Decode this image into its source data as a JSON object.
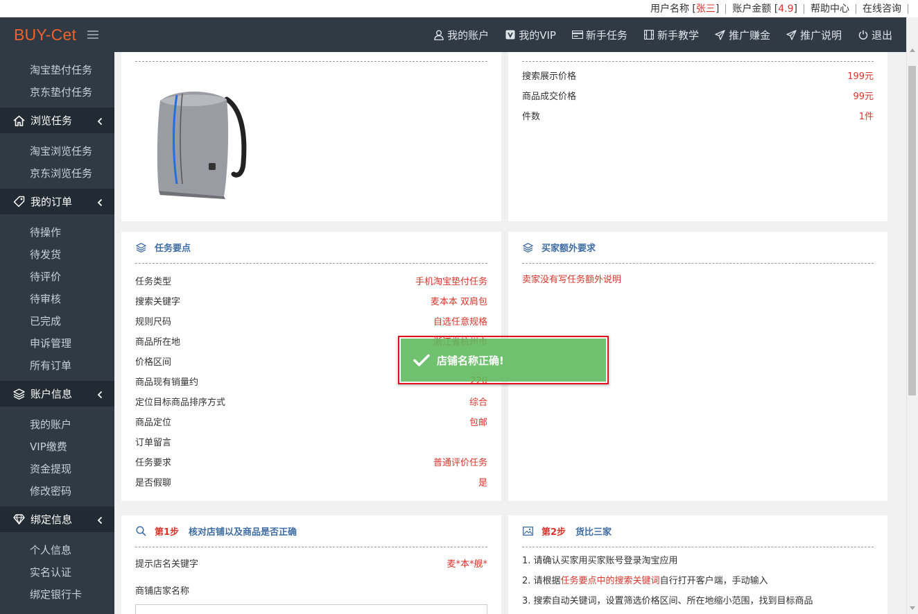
{
  "topbar": {
    "username_label": "用户名称 [",
    "username_value": "张三",
    "username_close": "]",
    "balance_label": "账户金额 [",
    "balance_value": "4.9",
    "balance_close": "]",
    "help": "帮助中心",
    "consult": "在线咨询"
  },
  "header": {
    "logo": "BUY-Cet",
    "nav": [
      {
        "label": "我的账户",
        "icon": "user-icon"
      },
      {
        "label": "我的VIP",
        "icon": "vip-icon"
      },
      {
        "label": "新手任务",
        "icon": "card-icon"
      },
      {
        "label": "新手教学",
        "icon": "film-icon"
      },
      {
        "label": "推广赚金",
        "icon": "send-icon"
      },
      {
        "label": "推广说明",
        "icon": "send-icon"
      },
      {
        "label": "退出",
        "icon": "power-icon"
      }
    ]
  },
  "sidebar": {
    "pay_items": [
      "淘宝垫付任务",
      "京东垫付任务"
    ],
    "browse": {
      "title": "浏览任务",
      "items": [
        "淘宝浏览任务",
        "京东浏览任务"
      ]
    },
    "orders": {
      "title": "我的订单",
      "items": [
        "待操作",
        "待发货",
        "待评价",
        "待审核",
        "已完成",
        "申诉管理",
        "所有订单"
      ]
    },
    "account": {
      "title": "账户信息",
      "items": [
        "我的账户",
        "VIP缴费",
        "资金提现",
        "修改密码"
      ]
    },
    "bind": {
      "title": "绑定信息",
      "items": [
        "个人信息",
        "实名认证",
        "绑定银行卡"
      ]
    }
  },
  "price_panel": {
    "rows": [
      {
        "label": "搜索展示价格",
        "value": "199元"
      },
      {
        "label": "商品成交价格",
        "value": "99元"
      },
      {
        "label": "件数",
        "value": "1件"
      }
    ]
  },
  "task_points": {
    "title": "任务要点",
    "rows": [
      {
        "label": "任务类型",
        "value": "手机淘宝垫付任务"
      },
      {
        "label": "搜索关键字",
        "value": "麦本本 双肩包"
      },
      {
        "label": "规则尺码",
        "value": "自选任意规格"
      },
      {
        "label": "商品所在地",
        "value": "浙江省杭州市"
      },
      {
        "label": "价格区间",
        "value": ""
      },
      {
        "label": "商品现有销量约",
        "value": "220"
      },
      {
        "label": "定位目标商品排序方式",
        "value": "综合"
      },
      {
        "label": "商品定位",
        "value": "包邮"
      },
      {
        "label": "订单留言",
        "value": ""
      },
      {
        "label": "任务要求",
        "value": "普通评价任务"
      },
      {
        "label": "是否假聊",
        "value": "是"
      }
    ]
  },
  "buyer_extra": {
    "title": "买家额外要求",
    "note": "卖家没有写任务额外说明"
  },
  "step1": {
    "step": "第1步",
    "title": "核对店铺以及商品是否正确",
    "hint_label": "提示店名关键字",
    "hint_value": "麦*本*舰*",
    "shop_label": "商铺店家名称"
  },
  "step2": {
    "step": "第2步",
    "title": "货比三家",
    "line1": "1. 请确认买家用买家账号登录淘宝应用",
    "line2_pre": "2. 请根据",
    "line2_red": "任务要点中的搜索关键词",
    "line2_post": "自行打开客户端，手动输入",
    "line3": "3. 搜索自动关键词，设置筛选价格区间、所在地缩小范围，找到目标商品"
  },
  "toast": {
    "message": "店铺名称正确!"
  },
  "colors": {
    "header_bg": "#2f3a45",
    "accent_red": "#d9342b",
    "logo_orange": "#f0622c",
    "title_blue": "#3e6ca3",
    "toast_green": "#5cb85c"
  }
}
